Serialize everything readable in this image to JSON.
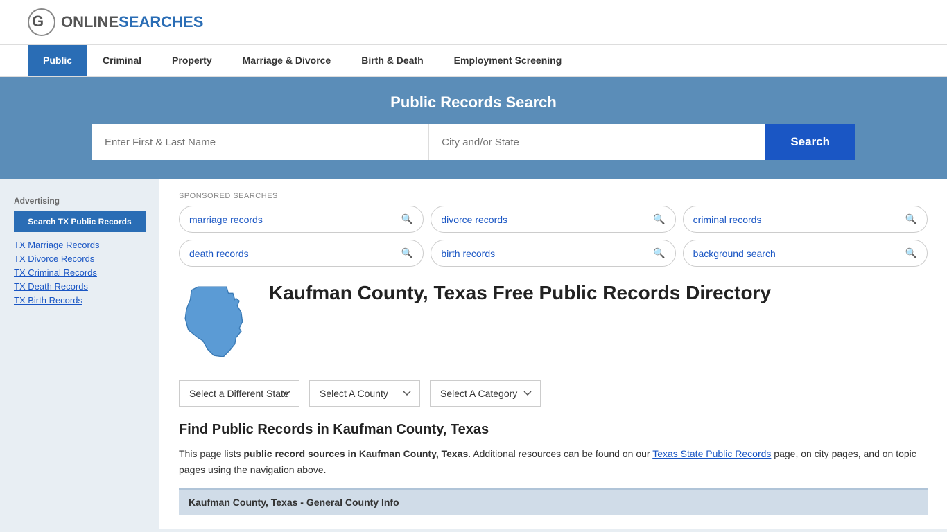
{
  "logo": {
    "text_online": "ONLINE",
    "text_searches": "SEARCHES"
  },
  "nav": {
    "items": [
      {
        "label": "Public",
        "active": true
      },
      {
        "label": "Criminal",
        "active": false
      },
      {
        "label": "Property",
        "active": false
      },
      {
        "label": "Marriage & Divorce",
        "active": false
      },
      {
        "label": "Birth & Death",
        "active": false
      },
      {
        "label": "Employment Screening",
        "active": false
      }
    ]
  },
  "hero": {
    "title": "Public Records Search",
    "name_placeholder": "Enter First & Last Name",
    "location_placeholder": "City and/or State",
    "search_label": "Search"
  },
  "sponsored": {
    "label": "SPONSORED SEARCHES",
    "pills": [
      {
        "text": "marriage records"
      },
      {
        "text": "divorce records"
      },
      {
        "text": "criminal records"
      },
      {
        "text": "death records"
      },
      {
        "text": "birth records"
      },
      {
        "text": "background search"
      }
    ]
  },
  "page_title": "Kaufman County, Texas Free Public Records Directory",
  "dropdowns": {
    "state": "Select a Different State",
    "county": "Select A County",
    "category": "Select A Category"
  },
  "find_section": {
    "title": "Find Public Records in Kaufman County, Texas",
    "description_parts": [
      "This page lists ",
      "public record sources in Kaufman County, Texas",
      ". Additional resources can be found on our ",
      "Texas State Public Records",
      " page, on city pages, and on topic pages using the navigation above."
    ]
  },
  "county_info_header": "Kaufman County, Texas - General County Info",
  "sidebar": {
    "ad_label": "Advertising",
    "ad_button": "Search TX Public Records",
    "links": [
      {
        "label": "TX Marriage Records"
      },
      {
        "label": "TX Divorce Records"
      },
      {
        "label": "TX Criminal Records"
      },
      {
        "label": "TX Death Records"
      },
      {
        "label": "TX Birth Records"
      }
    ]
  }
}
